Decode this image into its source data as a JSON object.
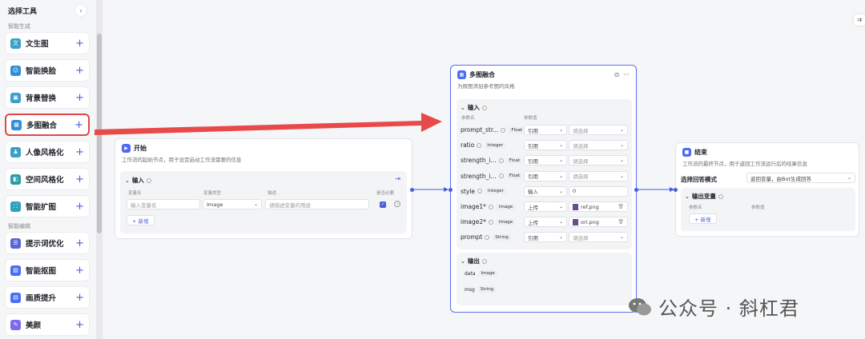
{
  "sidebar": {
    "title": "选择工具",
    "collapse_glyph": "‹",
    "section1": "智能生成",
    "section2": "智能编辑",
    "items": [
      {
        "label": "文生图",
        "icon": "text-to-image-icon",
        "glyph": "文"
      },
      {
        "label": "智能换脸",
        "icon": "face-swap-icon",
        "glyph": "☺"
      },
      {
        "label": "背景替换",
        "icon": "background-replace-icon",
        "glyph": "▣"
      },
      {
        "label": "多图融合",
        "icon": "multi-image-fusion-icon",
        "glyph": "▦"
      },
      {
        "label": "人像风格化",
        "icon": "portrait-style-icon",
        "glyph": "♟"
      },
      {
        "label": "空间风格化",
        "icon": "space-style-icon",
        "glyph": "◧"
      },
      {
        "label": "智能扩图",
        "icon": "image-expand-icon",
        "glyph": "⛶"
      },
      {
        "label": "提示词优化",
        "icon": "prompt-optimize-icon",
        "glyph": "☰"
      },
      {
        "label": "智能抠图",
        "icon": "smart-cutout-icon",
        "glyph": "▨"
      },
      {
        "label": "画质提升",
        "icon": "quality-enhance-icon",
        "glyph": "▤"
      },
      {
        "label": "美颜",
        "icon": "beauty-icon",
        "glyph": "✎"
      }
    ],
    "plus": "+"
  },
  "start_node": {
    "title": "开始",
    "desc": "工作流的起始节点，用于设定启动工作流需要的信息",
    "input_section": "输入",
    "col_var": "变量名",
    "col_type": "变量类型",
    "col_desc": "描述",
    "col_required": "是否必要",
    "var_placeholder": "输入变量名",
    "type_value": "Image",
    "desc_placeholder": "请描述变量的用途",
    "add_label": "+ 新增"
  },
  "fusion_node": {
    "title": "多图融合",
    "desc": "为原图添加参考图的风格",
    "input_section": "输入",
    "col_param": "参数名",
    "col_value": "参数值",
    "rows": [
      {
        "name": "prompt_str...",
        "type": "Float",
        "mode": "引用",
        "value": "请选择",
        "ph": true
      },
      {
        "name": "ratio",
        "type": "Integer",
        "mode": "引用",
        "value": "请选择",
        "ph": true
      },
      {
        "name": "strength_i...",
        "type": "Float",
        "mode": "引用",
        "value": "请选择",
        "ph": true
      },
      {
        "name": "strength_i...",
        "type": "Float",
        "mode": "引用",
        "value": "请选择",
        "ph": true
      },
      {
        "name": "style",
        "type": "Integer",
        "mode": "输入",
        "value": "0",
        "ph": false
      },
      {
        "name": "image1*",
        "type": "Image",
        "mode": "上传",
        "value": "ref.png",
        "ph": false,
        "file": true
      },
      {
        "name": "image2*",
        "type": "Image",
        "mode": "上传",
        "value": "ori.png",
        "ph": false,
        "file": true
      },
      {
        "name": "prompt",
        "type": "String",
        "mode": "引用",
        "value": "请选择",
        "ph": true
      }
    ],
    "output_section": "输出",
    "outputs": [
      {
        "name": "data",
        "type": "Image"
      },
      {
        "name": "msg",
        "type": "String"
      }
    ]
  },
  "end_node": {
    "title": "结束",
    "desc": "工作流的最终节点，用于返回工作流运行后的结果信息",
    "mode_label": "选择回答模式",
    "mode_value": "返回变量，由Bot生成回答",
    "output_section": "输出变量",
    "col_param": "参数名",
    "col_value": "参数值",
    "add_label": "+ 新增"
  },
  "watermark": "公众号 · 斜杠君",
  "colors": {
    "accent": "#4a5fd9",
    "highlight": "#e04848"
  }
}
